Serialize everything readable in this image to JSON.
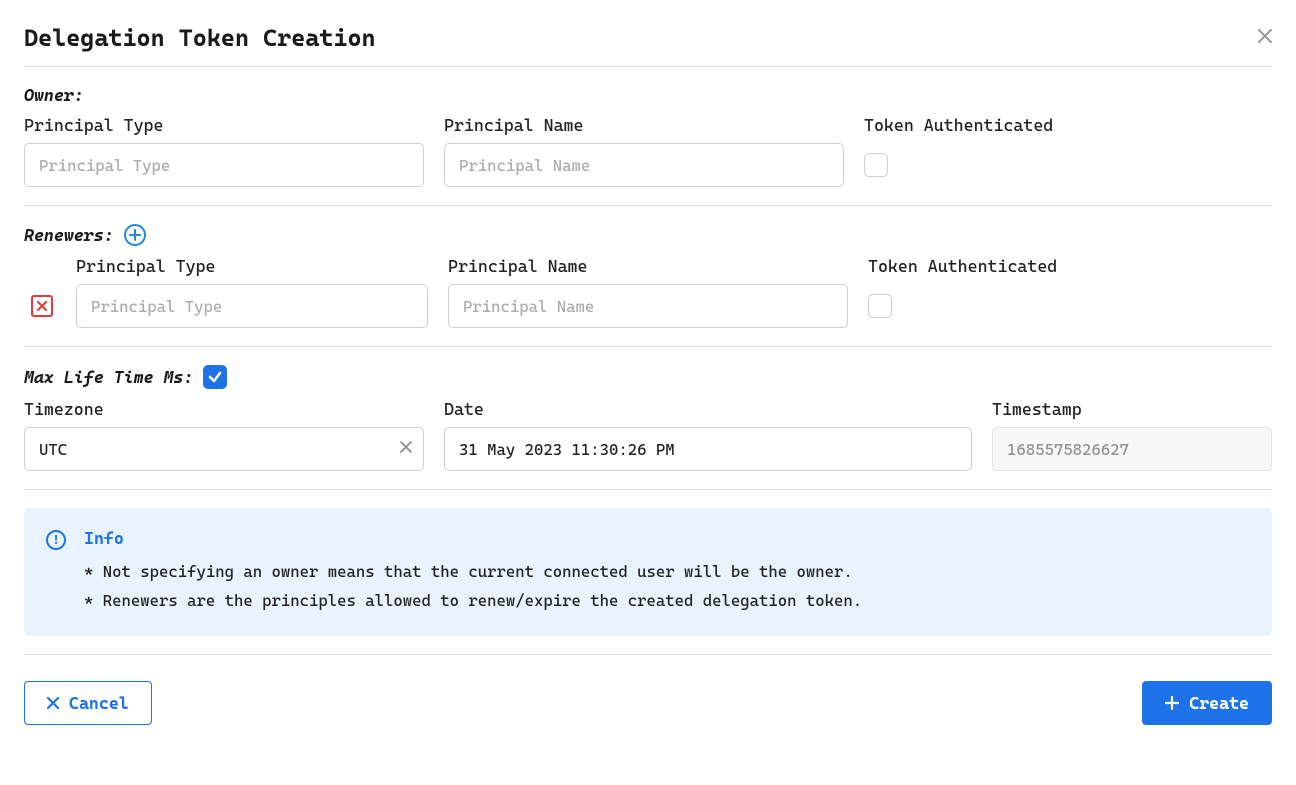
{
  "header": {
    "title": "Delegation Token Creation"
  },
  "owner": {
    "label": "Owner:",
    "principal_type_label": "Principal Type",
    "principal_type_placeholder": "Principal Type",
    "principal_type_value": "",
    "principal_name_label": "Principal Name",
    "principal_name_placeholder": "Principal Name",
    "principal_name_value": "",
    "token_auth_label": "Token Authenticated",
    "token_auth_checked": false
  },
  "renewers": {
    "label": "Renewers:",
    "items": [
      {
        "principal_type_label": "Principal Type",
        "principal_type_placeholder": "Principal Type",
        "principal_type_value": "",
        "principal_name_label": "Principal Name",
        "principal_name_placeholder": "Principal Name",
        "principal_name_value": "",
        "token_auth_label": "Token Authenticated",
        "token_auth_checked": false
      }
    ]
  },
  "maxlife": {
    "label": "Max Life Time Ms:",
    "enabled": true,
    "timezone_label": "Timezone",
    "timezone_value": "UTC",
    "date_label": "Date",
    "date_value": "31 May 2023 11:30:26 PM",
    "timestamp_label": "Timestamp",
    "timestamp_value": "1685575826627"
  },
  "info": {
    "title": "Info",
    "body": "* Not specifying an owner means that the current connected user will be the owner.\n* Renewers are the principles allowed to renew/expire the created delegation token."
  },
  "footer": {
    "cancel_label": "Cancel",
    "create_label": "Create"
  }
}
